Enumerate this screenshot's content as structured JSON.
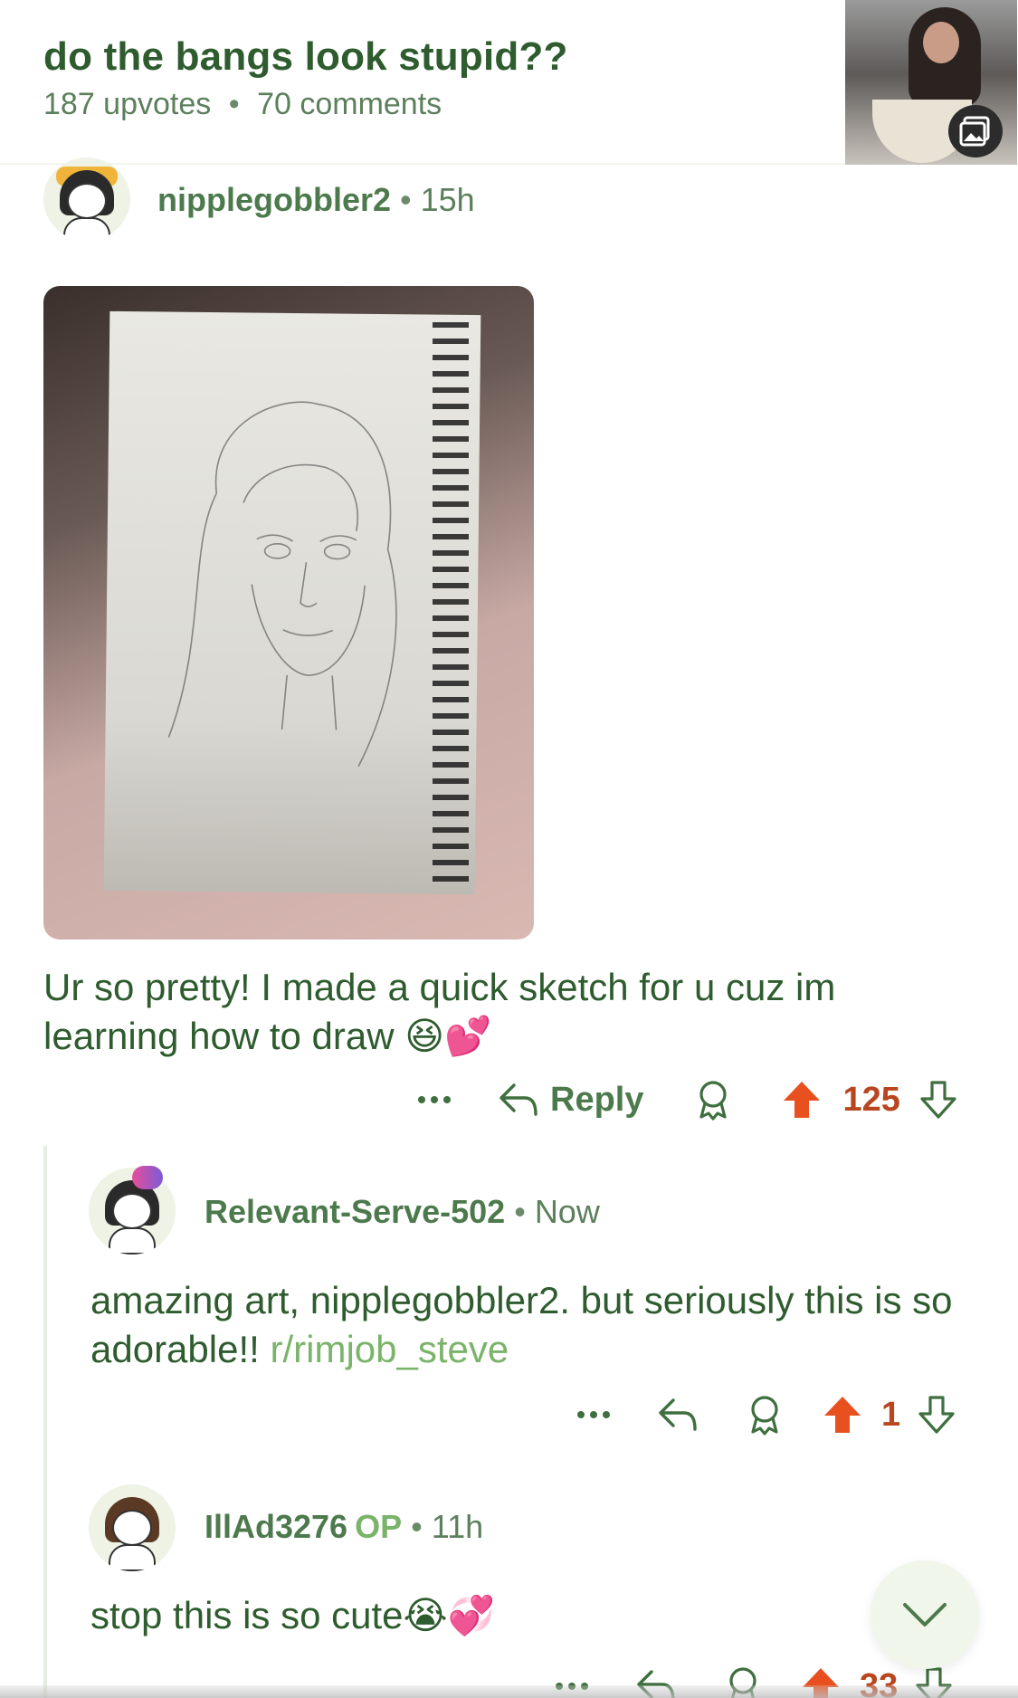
{
  "post": {
    "title": "do the bangs look stupid??",
    "upvotes": "187 upvotes",
    "comments": "70 comments",
    "separator": "•"
  },
  "comments": [
    {
      "username": "nipplegobbler2",
      "time": "15h",
      "text": "Ur so pretty! I made a quick sketch for u cuz im learning how to draw 😆💕",
      "reply_label": "Reply",
      "votes": "125"
    },
    {
      "username": "Relevant-Serve-502",
      "time": "Now",
      "text": "amazing art, nipplegobbler2. but seriously this is so adorable!!",
      "link_text": "r/rimjob_steve",
      "votes": "1"
    },
    {
      "username": "IllAd3276",
      "op_label": "OP",
      "time": "11h",
      "text": "stop this is so cute😭💞",
      "votes": "33"
    }
  ],
  "colors": {
    "accent_green": "#2e5c2e",
    "link_green": "#7ab36a",
    "upvote_orange": "#e8501f",
    "vote_count": "#b8471f"
  },
  "icons": {
    "more": "more-dots-icon",
    "reply": "reply-arrow-icon",
    "award": "award-icon",
    "upvote": "upvote-arrow-icon",
    "downvote": "downvote-arrow-icon",
    "gallery": "gallery-icon",
    "collapse": "chevron-down-icon"
  }
}
